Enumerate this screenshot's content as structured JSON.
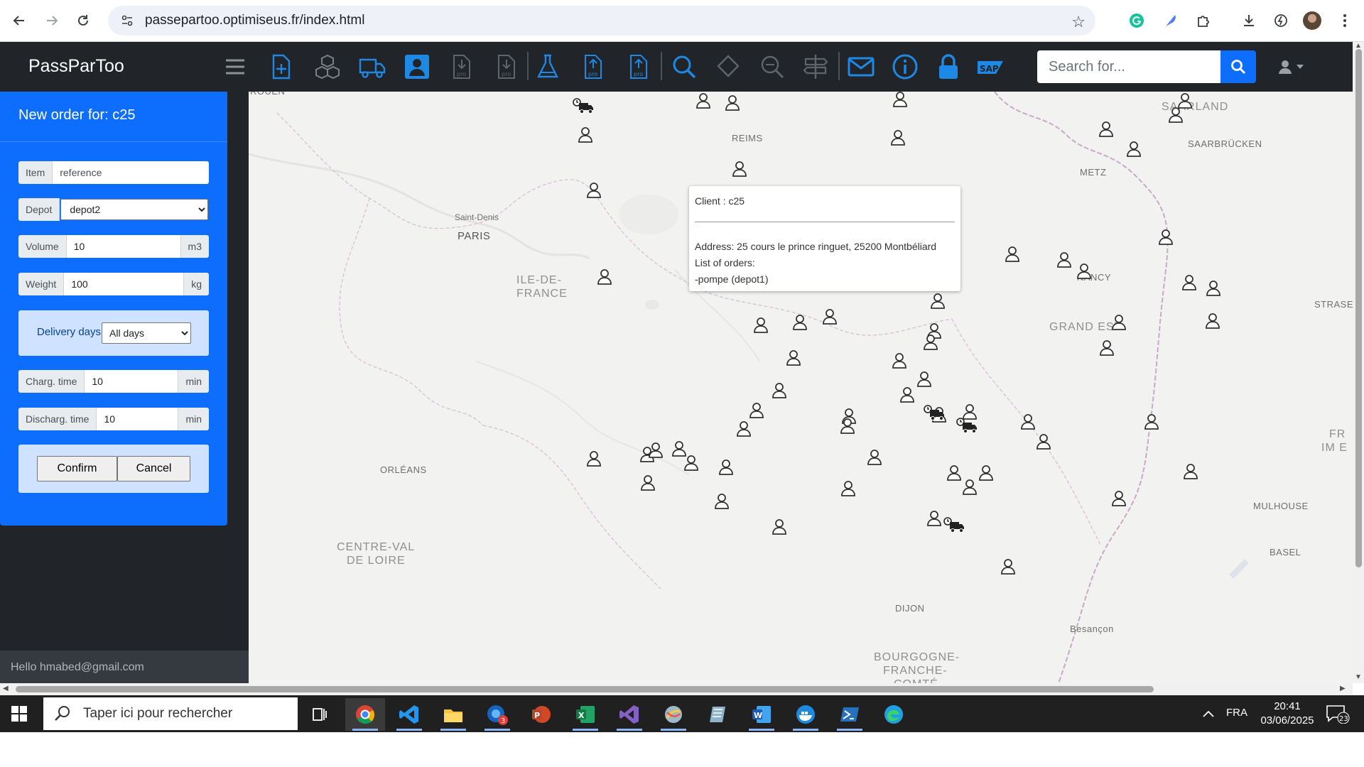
{
  "browser": {
    "url": "passepartoo.optimiseus.fr/index.html"
  },
  "app": {
    "brand": "PassParToo"
  },
  "navbar": {
    "search_placeholder": "Search for..."
  },
  "order_form": {
    "title": "New order for: c25",
    "item_label": "Item",
    "item_placeholder": "reference",
    "depot_label": "Depot",
    "depot_value": "depot2",
    "volume_label": "Volume",
    "volume_value": "10",
    "volume_unit": "m3",
    "weight_label": "Weight",
    "weight_value": "100",
    "weight_unit": "kg",
    "delivery_label": "Delivery days:",
    "delivery_value": "All days",
    "charg_label": "Charg. time",
    "charg_value": "10",
    "charg_unit": "min",
    "discharg_label": "Discharg. time",
    "discharg_value": "10",
    "discharg_unit": "min",
    "confirm_label": "Confirm",
    "cancel_label": "Cancel"
  },
  "sidebar": {
    "hello": "Hello hmabed@gmail.com"
  },
  "map": {
    "labels": {
      "rouen": "ROUEN",
      "reims": "REIMS",
      "saarland": "SAARLAND",
      "saarbrucken": "SAARBRÜCKEN",
      "metz": "METZ",
      "saint_denis": "Saint-Denis",
      "paris": "PARIS",
      "ile_de_france_1": "ILE-DE-",
      "ile_de_france_2": "FRANCE",
      "nancy": "NANCY",
      "strase": "STRASE",
      "grand_est": "GRAND EST",
      "orleans": "ORLÉANS",
      "fr_im_1": "FR",
      "fr_im_2": "IM E",
      "mulhouse": "MULHOUSE",
      "centre_1": "CENTRE-VAL",
      "centre_2": "DE LOIRE",
      "basel": "BASEL",
      "dijon": "DIJON",
      "besancon": "Besançon",
      "bourgogne_1": "BOURGOGNE-",
      "bourgogne_2": "FRANCHE-",
      "bourgogne_3": "COMTÉ"
    },
    "popup": {
      "client": "Client : c25",
      "address": "Address: 25 cours le prince ringuet, 25200 Montbéliard",
      "list_title": "List of orders:",
      "order": "-pompe (depot1)"
    }
  },
  "taskbar": {
    "search_text": "Taper ici pour rechercher",
    "outlook_badge": "3",
    "language": "FRA",
    "time": "20:41",
    "date": "03/06/2025",
    "notifications": "23"
  },
  "colors": {
    "navbar": "#212529",
    "primary": "#0d6efd",
    "panel_box": "#cfe2ff",
    "taskbar": "#202020"
  }
}
